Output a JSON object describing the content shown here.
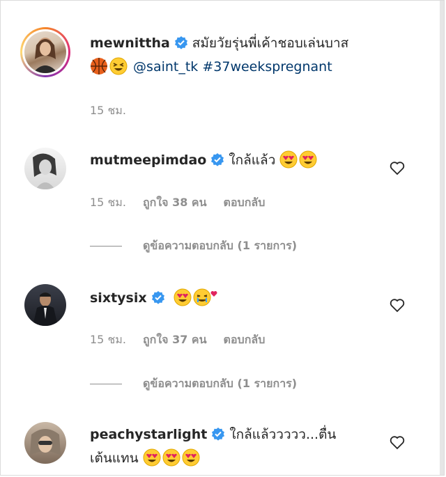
{
  "comments": [
    {
      "username": "mewnittha",
      "text": "สมัยวัยรุ่นพี่เค้าชอบเล่นบาส",
      "mention": "@saint_tk",
      "hashtag": "#37weekspregnant",
      "time": "15 ชม.",
      "emojis": [
        "basketball-icon",
        "laughing-face-icon"
      ]
    },
    {
      "username": "mutmeepimdao",
      "text": "ใกล้แล้ว",
      "time": "15 ชม.",
      "likes": "ถูกใจ 38 คน",
      "reply": "ตอบกลับ",
      "view_replies": "ดูข้อความตอบกลับ (1 รายการ)",
      "emojis": [
        "heart-eyes-icon",
        "heart-eyes-icon"
      ]
    },
    {
      "username": "sixtysix",
      "text": "",
      "time": "15 ชม.",
      "likes": "ถูกใจ 37 คน",
      "reply": "ตอบกลับ",
      "view_replies": "ดูข้อความตอบกลับ (1 รายการ)",
      "emojis": [
        "heart-eyes-icon",
        "crying-laughing-heart-icon"
      ]
    },
    {
      "username": "peachystarlight",
      "text": "ใกล้แล้ววววว...ตื่น",
      "text2": "เต้นแทน",
      "emojis": [
        "heart-eyes-icon",
        "heart-eyes-icon",
        "heart-eyes-icon"
      ]
    }
  ],
  "colors": {
    "verified": "#3897f0",
    "mention": "#00376b",
    "meta": "#8e8e8e"
  }
}
